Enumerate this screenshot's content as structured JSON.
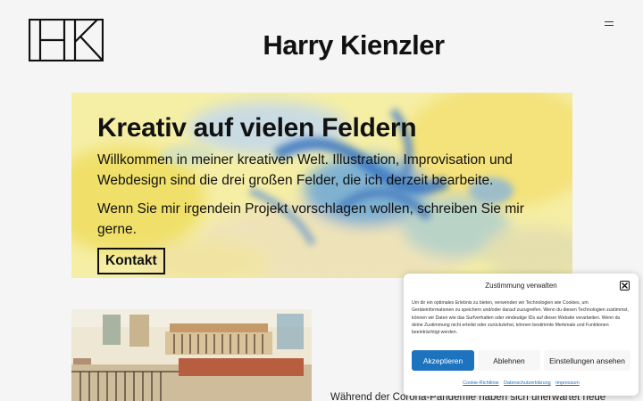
{
  "header": {
    "site_title": "Harry Kienzler",
    "logo_name": "hk-logo",
    "menu_icon": "hamburger-icon"
  },
  "hero": {
    "title": "Kreativ auf vielen Feldern",
    "paragraph1": "Willkommen in meiner kreativen Welt. Illustration, Improvisation und Webdesign sind die drei großen Felder, die ich derzeit bearbeite.",
    "paragraph2": "Wenn Sie mir irgendein Projekt vorschlagen wollen, schreiben Sie mir gerne.",
    "button_label": "Kontakt"
  },
  "content": {
    "intro_text": "Während der Corona-Pandemie haben sich unerwartet neue"
  },
  "cookie_banner": {
    "title": "Zustimmung verwalten",
    "text": "Um dir ein optimales Erlebnis zu bieten, verwenden wir Technologien wie Cookies, um Geräteinformationen zu speichern und/oder darauf zuzugreifen. Wenn du diesen Technologien zustimmst, können wir Daten wie das Surfverhalten oder eindeutige IDs auf dieser Website verarbeiten. Wenn du deine Zustimmung nicht erteilst oder zurückziehst, können bestimmte Merkmale und Funktionen beeinträchtigt werden.",
    "accept_label": "Akzeptieren",
    "deny_label": "Ablehnen",
    "settings_label": "Einstellungen ansehen",
    "links": [
      "Cookie-Richtlinie",
      "Datenschutzerklärung",
      "Impressum"
    ],
    "accent_color": "#1e73be"
  }
}
